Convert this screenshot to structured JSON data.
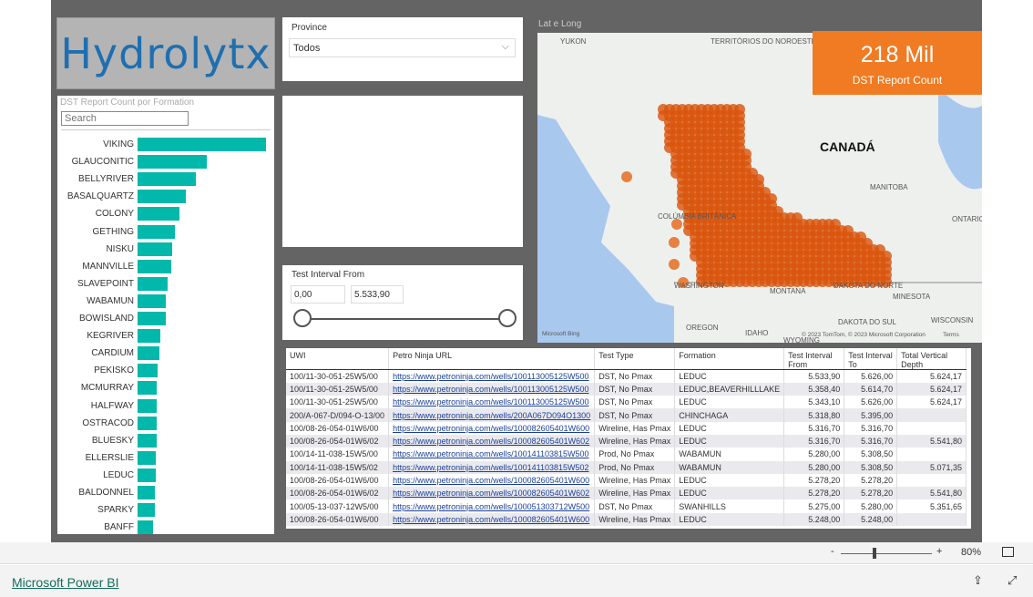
{
  "logo_text": "Hydrolytx",
  "bar_chart": {
    "title": "DST Report Count por Formation",
    "search_placeholder": "Search",
    "categories": [
      "VIKING",
      "GLAUCONITIC",
      "BELLYRIVER",
      "BASALQUARTZ",
      "COLONY",
      "GETHING",
      "NISKU",
      "MANNVILLE",
      "SLAVEPOINT",
      "WABAMUN",
      "BOWISLAND",
      "KEGRIVER",
      "CARDIUM",
      "PEKISKO",
      "MCMURRAY",
      "HALFWAY",
      "OSTRACOD",
      "BLUESKY",
      "ELLERSLIE",
      "LEDUC",
      "BALDONNEL",
      "SPARKY",
      "BANFF"
    ],
    "relative_values": [
      141,
      76,
      64,
      53,
      46,
      41,
      38,
      37,
      33,
      31,
      31,
      25,
      24,
      22,
      21,
      21,
      21,
      21,
      20,
      20,
      19,
      19,
      17
    ],
    "bar_color": "#01b8aa"
  },
  "province": {
    "label": "Province",
    "value": "Todos"
  },
  "slider": {
    "label": "Test Interval From",
    "min": "0,00",
    "max": "5.533,90"
  },
  "map": {
    "title": "Lat e Long",
    "labels": [
      "YUKON",
      "TERRITÓRIOS DO NOROESTE",
      "CANADÁ",
      "MANITOBA",
      "ONTARIO",
      "COLÚMBIA BRITÂNICA",
      "WASHINGTON",
      "MONTANA",
      "DAKOTA DO NORTE",
      "MINESOTA",
      "OREGON",
      "IDAHO",
      "DAKOTA DO SUL",
      "WISCONSIN",
      "WYOMING"
    ],
    "bing": "Microsoft Bing",
    "copyright": "© 2023 TomTom, © 2023 Microsoft Corporation",
    "terms": "Terms",
    "point_color": "#d9540b"
  },
  "kpi": {
    "value": "218 Mil",
    "label": "DST Report Count",
    "color": "#f07b22"
  },
  "table": {
    "columns": [
      "UWI",
      "Petro Ninja URL",
      "Test Type",
      "Formation",
      "Test Interval From",
      "Test Interval To",
      "Total Vertical Depth"
    ],
    "rows": [
      [
        "100/11-30-051-25W5/00",
        "https://www.petroninja.com/wells/100113005125W500",
        "DST, No Pmax",
        "LEDUC",
        "5.533,90",
        "5.626,00",
        "5.624,17"
      ],
      [
        "100/11-30-051-25W5/00",
        "https://www.petroninja.com/wells/100113005125W500",
        "DST, No Pmax",
        "LEDUC,BEAVERHILLLAKE",
        "5.358,40",
        "5.614,70",
        "5.624,17"
      ],
      [
        "100/11-30-051-25W5/00",
        "https://www.petroninja.com/wells/100113005125W500",
        "DST, No Pmax",
        "LEDUC",
        "5.343,10",
        "5.626,00",
        "5.624,17"
      ],
      [
        "200/A-067-D/094-O-13/00",
        "https://www.petroninja.com/wells/200A067D094O1300",
        "DST, No Pmax",
        "CHINCHAGA",
        "5.318,80",
        "5.395,00",
        ""
      ],
      [
        "100/08-26-054-01W6/00",
        "https://www.petroninja.com/wells/100082605401W600",
        "Wireline, Has Pmax",
        "LEDUC",
        "5.316,70",
        "5.316,70",
        ""
      ],
      [
        "100/08-26-054-01W6/02",
        "https://www.petroninja.com/wells/100082605401W602",
        "Wireline, Has Pmax",
        "LEDUC",
        "5.316,70",
        "5.316,70",
        "5.541,80"
      ],
      [
        "100/14-11-038-15W5/00",
        "https://www.petroninja.com/wells/100141103815W500",
        "Prod, No Pmax",
        "WABAMUN",
        "5.280,00",
        "5.308,50",
        ""
      ],
      [
        "100/14-11-038-15W5/02",
        "https://www.petroninja.com/wells/100141103815W502",
        "Prod, No Pmax",
        "WABAMUN",
        "5.280,00",
        "5.308,50",
        "5.071,35"
      ],
      [
        "100/08-26-054-01W6/00",
        "https://www.petroninja.com/wells/100082605401W600",
        "Wireline, Has Pmax",
        "LEDUC",
        "5.278,20",
        "5.278,20",
        ""
      ],
      [
        "100/08-26-054-01W6/02",
        "https://www.petroninja.com/wells/100082605401W602",
        "Wireline, Has Pmax",
        "LEDUC",
        "5.278,20",
        "5.278,20",
        "5.541,80"
      ],
      [
        "100/05-13-037-12W5/00",
        "https://www.petroninja.com/wells/100051303712W500",
        "DST, No Pmax",
        "SWANHILLS",
        "5.275,00",
        "5.280,00",
        "5.351,65"
      ],
      [
        "100/08-26-054-01W6/00",
        "https://www.petroninja.com/wells/100082605401W600",
        "Wireline, Has Pmax",
        "LEDUC",
        "5.248,00",
        "5.248,00",
        ""
      ]
    ]
  },
  "zoom": {
    "minus": "-",
    "plus": "+",
    "level": "80%",
    "level_fraction": 0.4
  },
  "footer": {
    "link": "Microsoft Power BI"
  }
}
